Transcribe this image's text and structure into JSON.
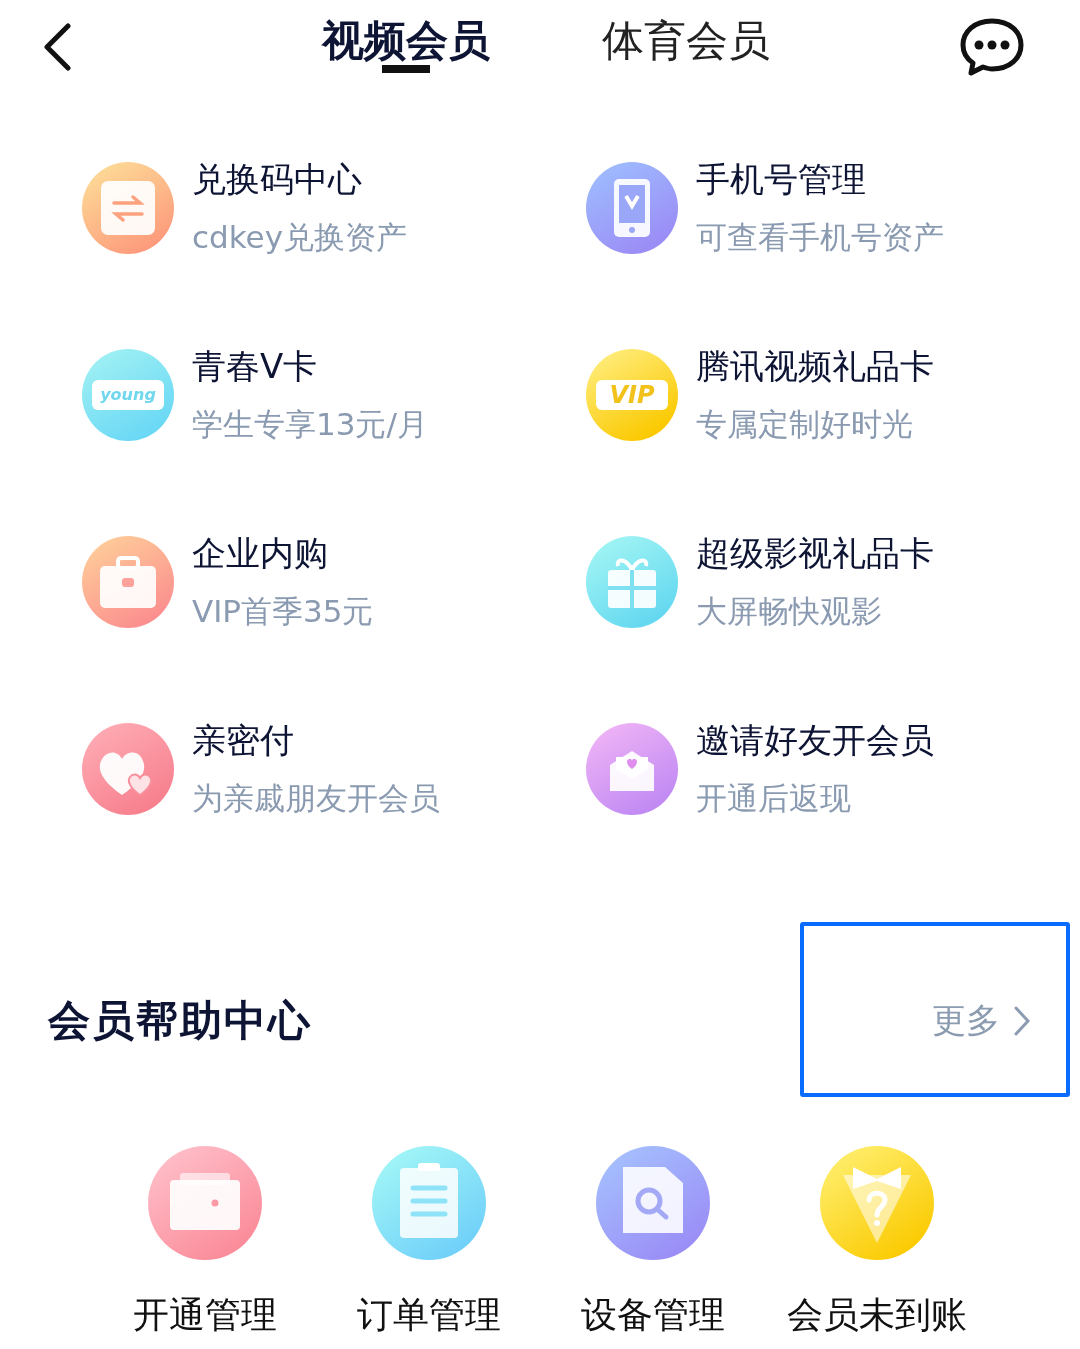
{
  "tabs": [
    {
      "label": "视频会员",
      "selected": true
    },
    {
      "label": "体育会员",
      "selected": false
    }
  ],
  "services": [
    {
      "kind": "exchange",
      "title": "兑换码中心",
      "subtitle": "cdkey兑换资产"
    },
    {
      "kind": "phone",
      "title": "手机号管理",
      "subtitle": "可查看手机号资产"
    },
    {
      "kind": "young",
      "title": "青春V卡",
      "subtitle": "学生专享13元/月",
      "icon_text": "young"
    },
    {
      "kind": "vip",
      "title": "腾讯视频礼品卡",
      "subtitle": "专属定制好时光",
      "icon_text": "VIP"
    },
    {
      "kind": "briefcase",
      "title": "企业内购",
      "subtitle": "VIP首季35元"
    },
    {
      "kind": "gift",
      "title": "超级影视礼品卡",
      "subtitle": "大屏畅快观影"
    },
    {
      "kind": "heart",
      "title": "亲密付",
      "subtitle": "为亲戚朋友开会员"
    },
    {
      "kind": "envelope",
      "title": "邀请好友开会员",
      "subtitle": "开通后返现"
    }
  ],
  "help_center": {
    "title": "会员帮助中心",
    "more": "更多",
    "more_highlighted": true,
    "items": [
      {
        "kind": "wallet",
        "label": "开通管理"
      },
      {
        "kind": "clipboard",
        "label": "订单管理"
      },
      {
        "kind": "search-doc",
        "label": "设备管理"
      },
      {
        "kind": "bowtie",
        "label": "会员未到账"
      }
    ]
  }
}
